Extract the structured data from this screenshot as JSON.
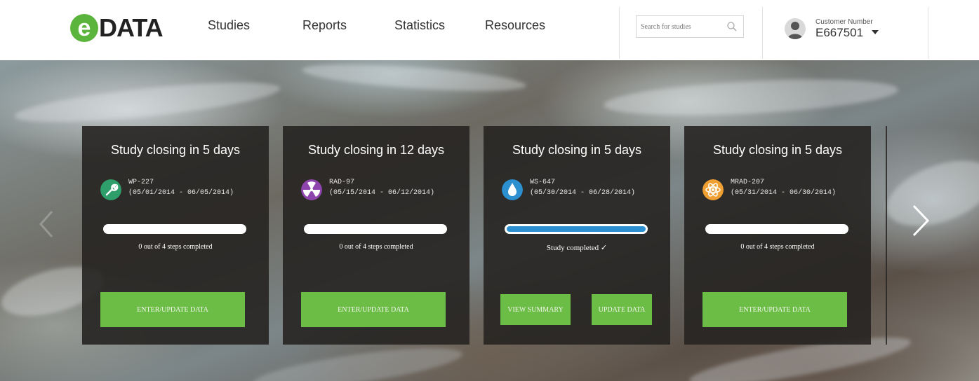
{
  "brand": {
    "logo_letter": "e",
    "logo_text": "DATA",
    "color": "#5bb53c"
  },
  "nav": [
    "Studies",
    "Reports",
    "Statistics",
    "Resources"
  ],
  "search": {
    "placeholder": "Search for studies",
    "icon": "search-icon"
  },
  "account": {
    "label": "Customer Number",
    "number": "E667501",
    "icon": "user-icon"
  },
  "cards": [
    {
      "title": "Study closing in 5 days",
      "study_id": "WP-227",
      "dates": "(05/01/2014 - 06/05/2014)",
      "icon": "wrench-icon",
      "icon_color": "#2e9e6b",
      "progress": 0,
      "status": "0 out of 4 steps completed",
      "buttons": [
        "ENTER/UPDATE DATA"
      ]
    },
    {
      "title": "Study closing in 12 days",
      "study_id": "RAD-97",
      "dates": "(05/15/2014 - 06/12/2014)",
      "icon": "radiation-icon",
      "icon_color": "#8e44ad",
      "progress": 0,
      "status": "0 out of 4 steps completed",
      "buttons": [
        "ENTER/UPDATE DATA"
      ]
    },
    {
      "title": "Study closing in 5 days",
      "study_id": "WS-647",
      "dates": "(05/30/2014 - 06/28/2014)",
      "icon": "water-drop-icon",
      "icon_color": "#2b8fd0",
      "progress": 1.0,
      "status": "Study completed ✓",
      "buttons": [
        "VIEW SUMMARY",
        "UPDATE DATA"
      ]
    },
    {
      "title": "Study closing in 5 days",
      "study_id": "MRAD-207",
      "dates": "(05/31/2014 - 06/30/2014)",
      "icon": "atom-icon",
      "icon_color": "#f0a030",
      "progress": 0,
      "status": "0 out of 4 steps completed",
      "buttons": [
        "ENTER/UPDATE DATA"
      ]
    }
  ],
  "colors": {
    "button_green": "#6cbd45",
    "progress_blue": "#2b8fd0"
  }
}
